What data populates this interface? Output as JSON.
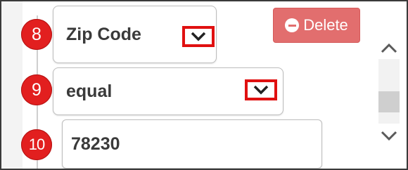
{
  "steps": {
    "s8": "8",
    "s9": "9",
    "s10": "10"
  },
  "filter": {
    "field_value": "Zip Code",
    "operator_value": "equal",
    "value": "78230"
  },
  "delete_label": "Delete",
  "icons": {
    "dropdown": "chevron-down-icon",
    "delete": "minus-circle-icon",
    "scroll_up": "chevron-up-icon",
    "scroll_down": "chevron-down-icon"
  },
  "colors": {
    "step_badge": "#e21f1f",
    "highlight": "#e01010",
    "delete_button": "#e26e6e"
  }
}
